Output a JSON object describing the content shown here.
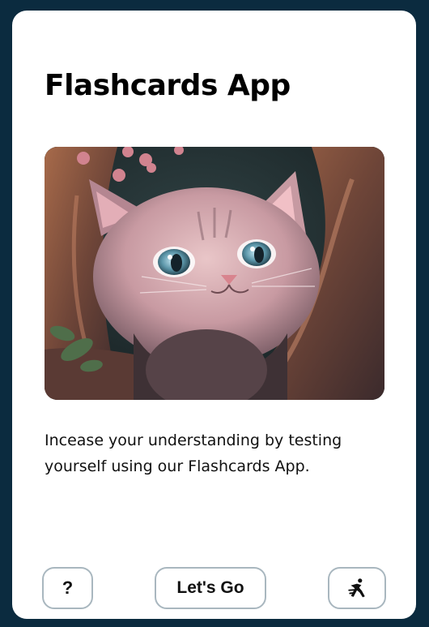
{
  "card": {
    "title": "Flashcards App",
    "image_alt": "Illustration of a pink kitten peeking out of a tree hollow",
    "description": "Incease your understanding by testing yourself using our Flashcards App."
  },
  "actions": {
    "help_label": "?",
    "start_label": "Let's Go",
    "accessibility_icon": "accessibility-icon"
  },
  "colors": {
    "page_background": "#0b2b3f",
    "card_background": "#ffffff",
    "button_border": "#a9b7bf"
  }
}
